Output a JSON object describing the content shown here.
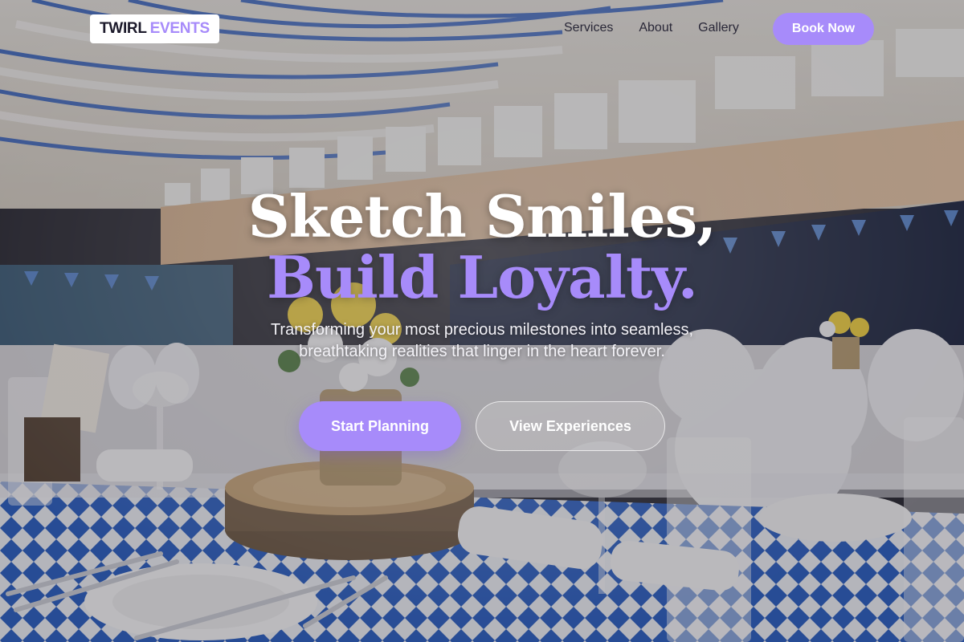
{
  "brand": {
    "name_part1": "TWIRL",
    "name_part2": "EVENTS"
  },
  "nav": {
    "links": [
      "Services",
      "About",
      "Gallery"
    ],
    "cta_label": "Book Now"
  },
  "hero": {
    "headline_line1": "Sketch Smiles,",
    "headline_line2": "Build Loyalty.",
    "subtitle": "Transforming your most precious milestones into seamless, breathtaking realities that linger in the heart forever.",
    "primary_cta": "Start Planning",
    "secondary_cta": "View Experiences"
  },
  "colors": {
    "accent": "#a78bfa",
    "headline": "#ffffff",
    "nav_text": "#2a2838"
  },
  "background": {
    "description_icon": "banquet-hall-photo"
  }
}
